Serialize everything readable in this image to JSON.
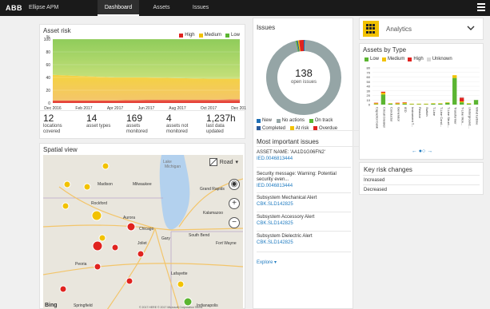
{
  "topbar": {
    "logo": "ABB",
    "app_name": "Ellipse APM",
    "tabs": [
      {
        "label": "Dashboard",
        "active": true
      },
      {
        "label": "Assets",
        "active": false
      },
      {
        "label": "Issues",
        "active": false
      }
    ],
    "menu_icon": "hamburger-menu-icon"
  },
  "asset_risk": {
    "title": "Asset risk",
    "y_unit": "%",
    "legend": [
      {
        "label": "High",
        "color": "#e0231f"
      },
      {
        "label": "Medium",
        "color": "#f2c200"
      },
      {
        "label": "Low",
        "color": "#5bb531"
      }
    ],
    "stats": [
      {
        "value": "12",
        "label": "locations covered"
      },
      {
        "value": "14",
        "label": "asset types"
      },
      {
        "value": "169",
        "label": "assets monitored"
      },
      {
        "value": "4",
        "label": "assets not monitored"
      },
      {
        "value": "1,237h",
        "label": "last data updated"
      }
    ]
  },
  "chart_data": {
    "type": "area",
    "title": "Asset risk",
    "ylabel": "%",
    "ylim": [
      0,
      100
    ],
    "y_ticks": [
      "100",
      "80",
      "60",
      "40",
      "20",
      "0"
    ],
    "x_ticks": [
      "Dec 2016",
      "Feb 2017",
      "Apr 2017",
      "Jun 2017",
      "Aug 2017",
      "Oct 2017",
      "Dec 2017"
    ],
    "stacked": true,
    "series": [
      {
        "name": "High",
        "color": "#e0231f",
        "values": [
          4,
          4,
          4,
          5,
          5,
          5,
          6
        ]
      },
      {
        "name": "Medium",
        "color": "#f2c200",
        "values": [
          40,
          38,
          36,
          35,
          34,
          33,
          32
        ]
      },
      {
        "name": "Low",
        "color": "#5bb531",
        "values": [
          56,
          58,
          60,
          60,
          61,
          62,
          62
        ]
      }
    ]
  },
  "spatial_view": {
    "title": "Spatial view",
    "map_type": "Road",
    "bing_label": "Bing",
    "copyright": "© 2017 HERE © 2017 Microsoft Corporation  Terms",
    "place_names": [
      "Chicago",
      "Milwaukee",
      "Madison",
      "Rockford",
      "Aurora",
      "Joliet",
      "Gary",
      "South Bend",
      "Grand Rapids",
      "Kalamazoo",
      "Peoria",
      "Springfield",
      "Indianapolis",
      "Lafayette",
      "Fort Wayne"
    ],
    "lake_label": "Lake Michigan"
  },
  "issues": {
    "title": "Issues",
    "count": "138",
    "count_label": "open issues",
    "legend": [
      {
        "label": "New",
        "color": "#1f6fb5"
      },
      {
        "label": "No actions",
        "color": "#95a5a6"
      },
      {
        "label": "On track",
        "color": "#5bb531"
      },
      {
        "label": "Completed",
        "color": "#2a5a9b"
      },
      {
        "label": "At risk",
        "color": "#f2c200"
      },
      {
        "label": "Overdue",
        "color": "#e0231f"
      }
    ],
    "donut_fractions": [
      0.005,
      0.96,
      0.005,
      0.005,
      0.005,
      0.02
    ]
  },
  "important_issues": {
    "title": "Most important issues",
    "items": [
      {
        "text": "ASSET NAME: 'AA1D1G06FN2'",
        "link": "IED.0046813444"
      },
      {
        "text": "Security message: Warning: Potential security even...",
        "link": "IED.0046813444"
      },
      {
        "text": "Subsystem Mechanical Alert",
        "link": "CBK.SLD142825"
      },
      {
        "text": "Subsystem Accessory Alert",
        "link": "CBK.SLD142825"
      },
      {
        "text": "Subsystem Dielectric Alert",
        "link": "CBK.SLD142825"
      }
    ],
    "explore_label": "Explore"
  },
  "analytics": {
    "label": "Analytics",
    "icon": "grid-icon"
  },
  "assets_by_type": {
    "title": "Assets by Type",
    "legend": [
      {
        "label": "Low",
        "color": "#5bb531"
      },
      {
        "label": "Medium",
        "color": "#f2c200"
      },
      {
        "label": "High",
        "color": "#e0231f"
      },
      {
        "label": "Unknown",
        "color": "#d9d9d9"
      }
    ]
  },
  "assets_chart": {
    "type": "bar",
    "ylim": [
      0,
      80
    ],
    "y_ticks": [
      "80",
      "70",
      "60",
      "50",
      "40",
      "30",
      "20",
      "10",
      "0"
    ],
    "categories": [
      "Capacitor bank",
      "Circuit breaker",
      "Conductor",
      "Generator",
      "IED",
      "Instrument T...",
      "Reactor",
      "Switch",
      "T-Line",
      "T-Line Cond...",
      "T-Line Struct...",
      "Transformer",
      "T-Line Mon...",
      "Underground...",
      "Wind turbine"
    ],
    "series": [
      {
        "name": "Low",
        "values": [
          1,
          22,
          2,
          1,
          2,
          1,
          1,
          1,
          2,
          2,
          4,
          58,
          5,
          2,
          10
        ]
      },
      {
        "name": "Medium",
        "values": [
          2,
          4,
          1,
          2,
          2,
          1,
          1,
          1,
          1,
          1,
          1,
          6,
          2,
          1,
          0
        ]
      },
      {
        "name": "High",
        "values": [
          1,
          2,
          0,
          1,
          1,
          0,
          0,
          0,
          0,
          0,
          0,
          0,
          8,
          0,
          0
        ]
      },
      {
        "name": "Unknown",
        "values": [
          0,
          0,
          0,
          0,
          0,
          0,
          0,
          0,
          0,
          0,
          0,
          0,
          2,
          0,
          0
        ]
      }
    ],
    "pager": {
      "prev": "←",
      "dots": "●○",
      "next": "→"
    }
  },
  "key_risk_changes": {
    "title": "Key risk changes",
    "rows": [
      {
        "label": "Increased"
      },
      {
        "label": "Decreased"
      }
    ]
  }
}
